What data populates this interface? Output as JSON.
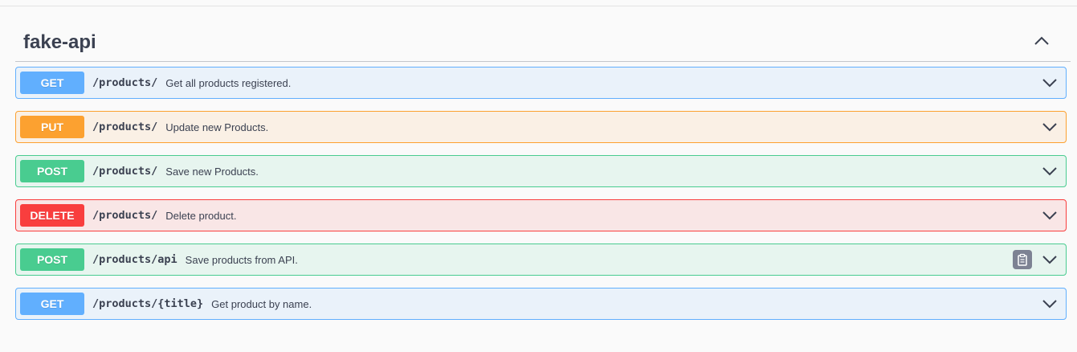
{
  "tag": {
    "title": "fake-api",
    "toggle_icon": "chevron-up-icon"
  },
  "operations": [
    {
      "method": "GET",
      "path": "/products/",
      "summary": "Get all products registered.",
      "color": "#61affe"
    },
    {
      "method": "PUT",
      "path": "/products/",
      "summary": "Update new Products.",
      "color": "#fca130"
    },
    {
      "method": "POST",
      "path": "/products/",
      "summary": "Save new Products.",
      "color": "#49cc90"
    },
    {
      "method": "DELETE",
      "path": "/products/",
      "summary": "Delete product.",
      "color": "#f93e3e"
    },
    {
      "method": "POST",
      "path": "/products/api",
      "summary": "Save products from API.",
      "color": "#49cc90",
      "copy_icon": "clipboard-copy-icon"
    },
    {
      "method": "GET",
      "path": "/products/{title}",
      "summary": "Get product by name.",
      "color": "#61affe"
    }
  ]
}
